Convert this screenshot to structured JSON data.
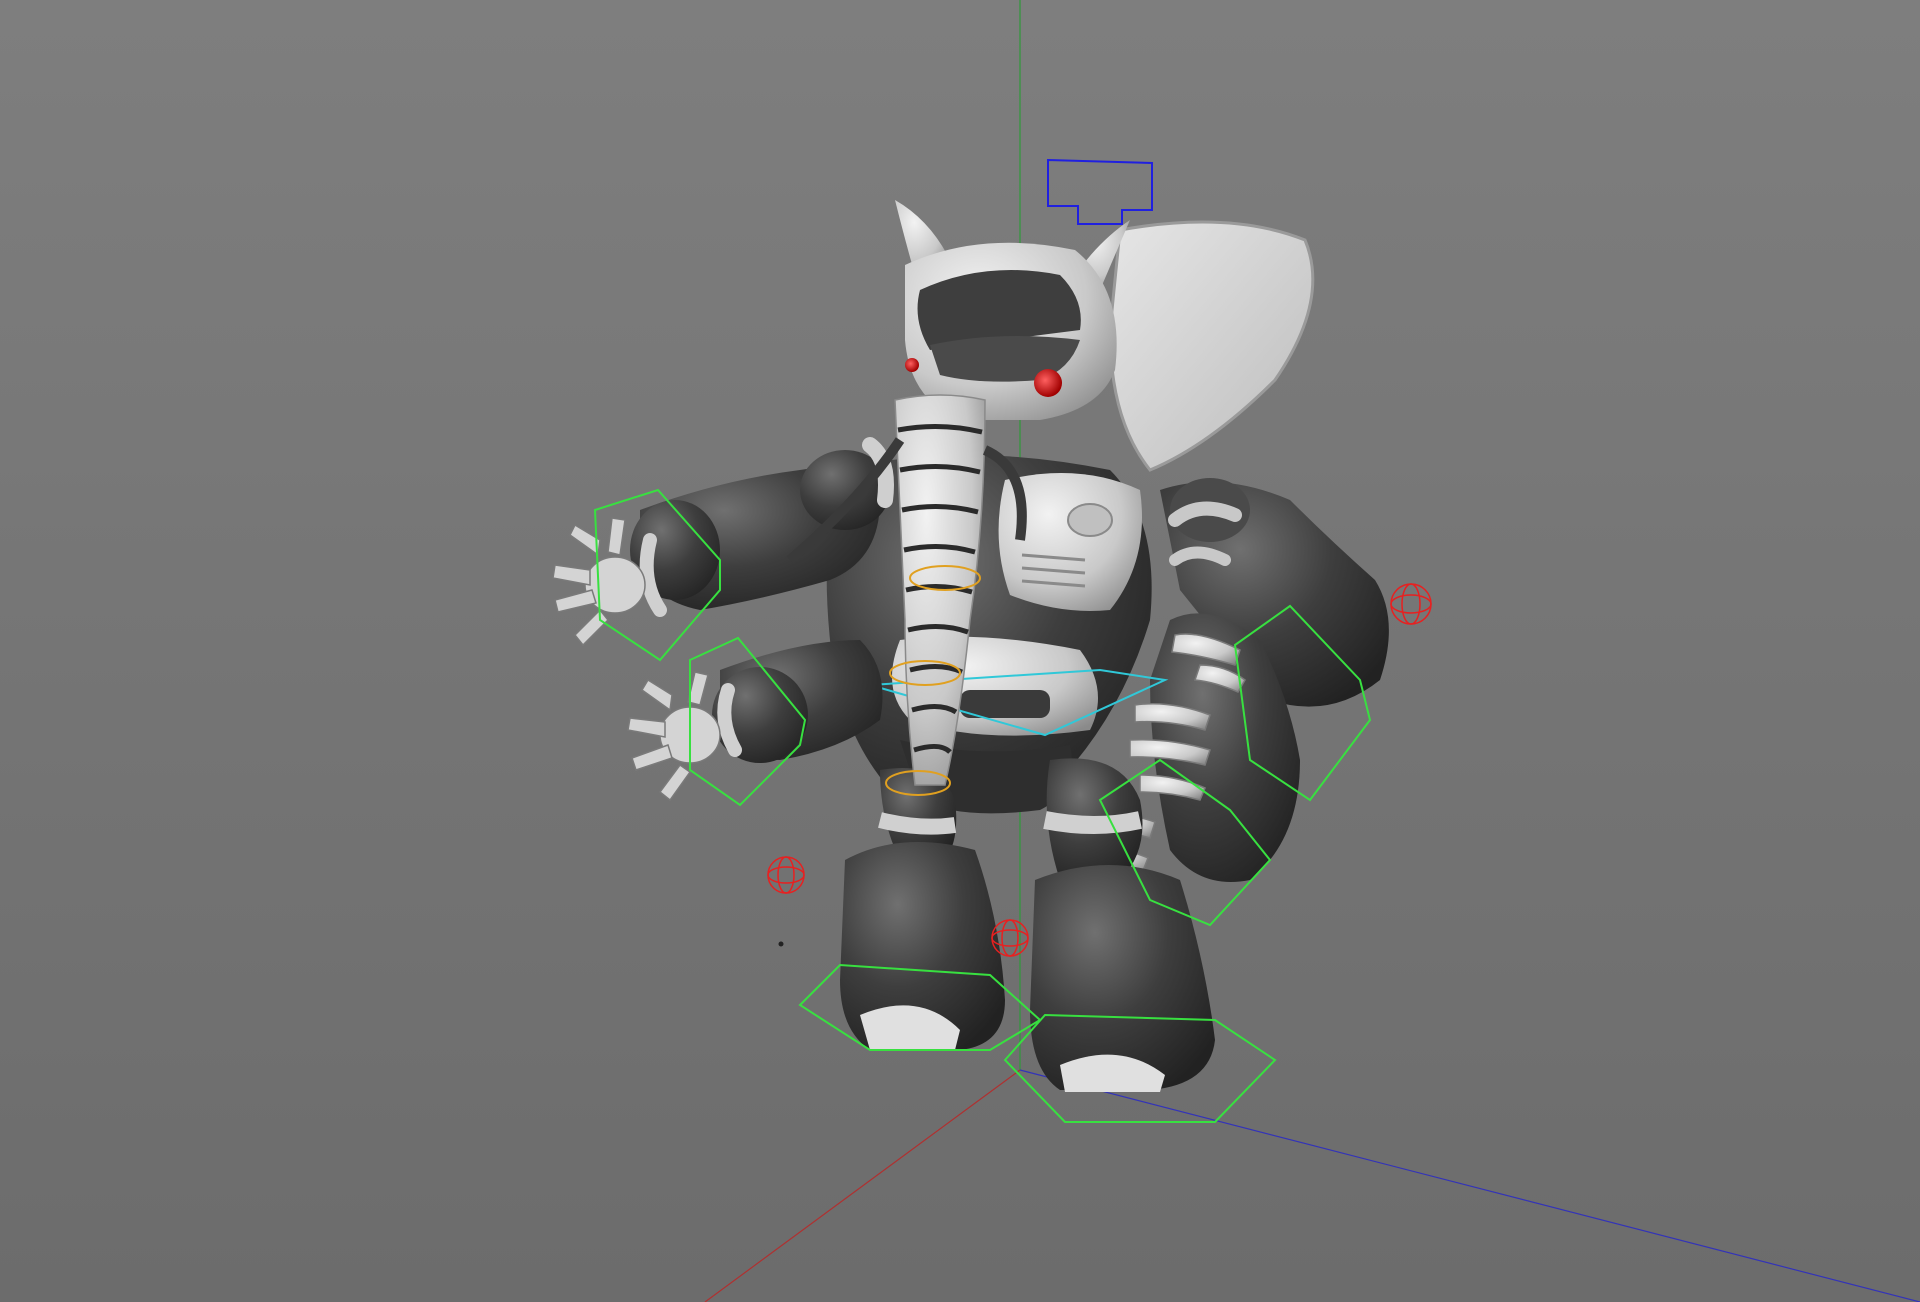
{
  "viewport": {
    "background_top": "#7e7e7e",
    "background_bottom": "#6c6c6c"
  },
  "colors": {
    "axis_x": "#b03030",
    "axis_y": "#2f9a3a",
    "axis_z": "#3333b8",
    "controller_green": "#38e040",
    "controller_red": "#e82020",
    "controller_yellow": "#e0a020",
    "controller_cyan": "#30c8d8",
    "controller_blue": "#2020e0",
    "model_dark": "#3b3b3b",
    "model_mid": "#5a5a5a",
    "model_light": "#d8d8d8",
    "eye": "#e01010"
  },
  "scene": {
    "object": "robot-elephant-character-rig",
    "icons": [
      "ik-hand-controller",
      "pole-target-controller",
      "foot-controller",
      "spine-ring-controller",
      "hip-controller",
      "head-controller"
    ]
  }
}
